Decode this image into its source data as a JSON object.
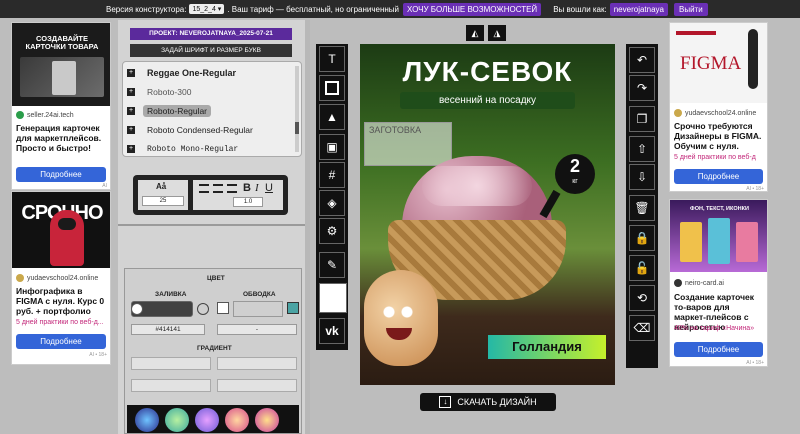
{
  "topbar": {
    "version_label": "Версия конструктора:",
    "version_value": "15_2_4",
    "tariff_text": ". Ваш тариф — бесплатный, но ограниченный",
    "upgrade_label": "ХОЧУ БОЛЬШЕ ВОЗМОЖНОСТЕЙ",
    "logged_label": "Вы вошли как:",
    "username": "neverojatnaya",
    "logout_label": "Выйти"
  },
  "ads": {
    "left_top": {
      "img_head": "СОЗДАВАЙТЕ КАРТОЧКИ ТОВАРА",
      "site": "seller.24ai.tech",
      "title": "Генерация карточек для маркетплейсов. Просто и быстро!",
      "button": "Подробнее",
      "ai": "AI"
    },
    "left_bottom": {
      "img_head": "СРОЧНО",
      "site": "yudaevschool24.online",
      "title": "Инфографика в FIGMA с нуля. Курс 0 руб. + портфолио",
      "sub": "5 дней практики по веб-д...",
      "button": "Подробнее",
      "ai": "AI • 18+"
    },
    "right_top": {
      "img_head": "FIGMA",
      "site": "yudaevschool24.online",
      "title": "Срочно требуются Дизайнеры в FIGMA. Обучим с нуля.",
      "sub": "5 дней практики по веб-д",
      "button": "Подробнее",
      "ai": "AI • 18+"
    },
    "right_bottom": {
      "img_head": "ФОН, ТЕКСТ, ИКОНКИ",
      "site": "neiro-card.ai",
      "title": "Создание карточек то-варов для маркет-плейсов с нейросетью",
      "sub": "40% на тариф «Начина»",
      "button": "Подробнее",
      "ai": "AI • 18+"
    }
  },
  "editor": {
    "project_label": "ПРОЕКТ: NEVEROJATNAYA_2025-07-21",
    "font_button": "ЗАДАЙ ШРИФТ И РАЗМЕР БУКВ",
    "fonts": [
      "Reggae One-Regular",
      "Roboto-300",
      "Roboto-Regular",
      "Roboto Condensed-Regular",
      "Roboto Mono-Regular"
    ],
    "font_size": "25",
    "line_height": "1.0",
    "color_title": "ЦВЕТ",
    "fill_label": "ЗАЛИВКА",
    "stroke_label": "ОБВОДКА",
    "fill_hex": "#414141",
    "stroke_hex": "-",
    "gradient_label": "ГРАДИЕНТ"
  },
  "canvas": {
    "title": "ЛУК-СЕВОК",
    "subtitle": "весенний на посадку",
    "placeholder": "ЗАГОТОВКА",
    "weight_num": "2",
    "weight_unit": "кг",
    "origin": "Голландия"
  },
  "download_label": "СКАЧАТЬ ДИЗАЙН",
  "colors": {
    "accent": "#6a2fb5",
    "button_blue": "#3465d8",
    "dark": "#111111",
    "fill_swatch": "#414141"
  }
}
